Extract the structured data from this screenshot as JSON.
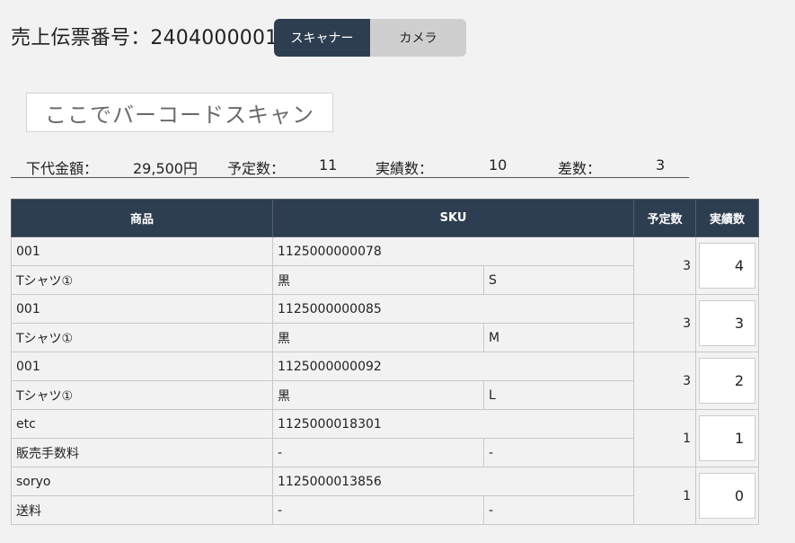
{
  "header": {
    "title_label": "売上伝票番号：",
    "slip_number": "2404000001"
  },
  "mode_toggle": {
    "options": [
      {
        "label": "スキャナー",
        "active": true
      },
      {
        "label": "カメラ",
        "active": false
      }
    ]
  },
  "scan_input": {
    "placeholder": "ここでバーコードスキャン"
  },
  "summary": {
    "cost_label": "下代金額：",
    "cost_value": "29,500円",
    "planned_label": "予定数：",
    "planned_value": "11",
    "actual_label": "実績数：",
    "actual_value": "10",
    "diff_label": "差数：",
    "diff_value": "3"
  },
  "table": {
    "headers": [
      "商品",
      "SKU",
      "予定数",
      "実績数"
    ],
    "rows": [
      {
        "code": "001",
        "name": "Tシャツ①",
        "sku": "1125000000078",
        "color": "黒",
        "size": "S",
        "planned": "3",
        "actual": "4"
      },
      {
        "code": "001",
        "name": "Tシャツ①",
        "sku": "1125000000085",
        "color": "黒",
        "size": "M",
        "planned": "3",
        "actual": "3"
      },
      {
        "code": "001",
        "name": "Tシャツ①",
        "sku": "1125000000092",
        "color": "黒",
        "size": "L",
        "planned": "3",
        "actual": "2"
      },
      {
        "code": "etc",
        "name": "販売手数料",
        "sku": "1125000018301",
        "color": "-",
        "size": "-",
        "planned": "1",
        "actual": "1"
      },
      {
        "code": "soryo",
        "name": "送料",
        "sku": "1125000013856",
        "color": "-",
        "size": "-",
        "planned": "1",
        "actual": "0"
      }
    ]
  },
  "colors": {
    "header_bg": "#2c3e50",
    "toggle_inactive": "#cfcfcf",
    "page_bg": "#f2f2f2"
  }
}
